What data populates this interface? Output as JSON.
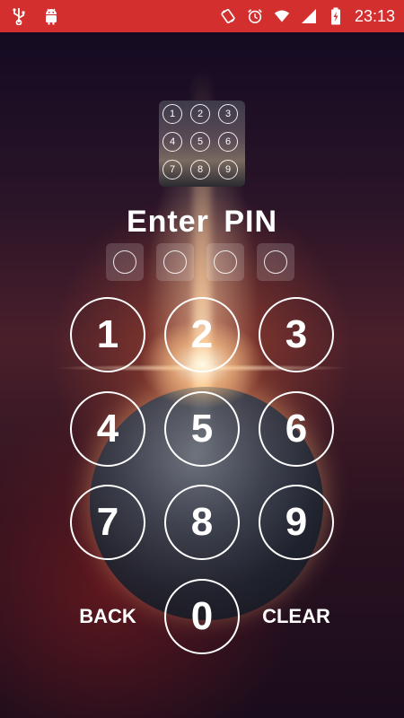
{
  "status_bar": {
    "left_icons": [
      "usb-icon",
      "android-icon"
    ],
    "right_icons": [
      "screen-rotation-icon",
      "alarm-icon",
      "wifi-icon",
      "signal-icon",
      "battery-charging-icon"
    ],
    "time": "23:13",
    "color": "#d32f2f"
  },
  "thumbnail": {
    "keys": [
      "1",
      "2",
      "3",
      "4",
      "5",
      "6",
      "7",
      "8",
      "9"
    ]
  },
  "title": "Enter PIN",
  "pin": {
    "length": 4
  },
  "keypad": {
    "keys": [
      "1",
      "2",
      "3",
      "4",
      "5",
      "6",
      "7",
      "8",
      "9",
      "0"
    ],
    "back_label": "BACK",
    "clear_label": "CLEAR"
  }
}
